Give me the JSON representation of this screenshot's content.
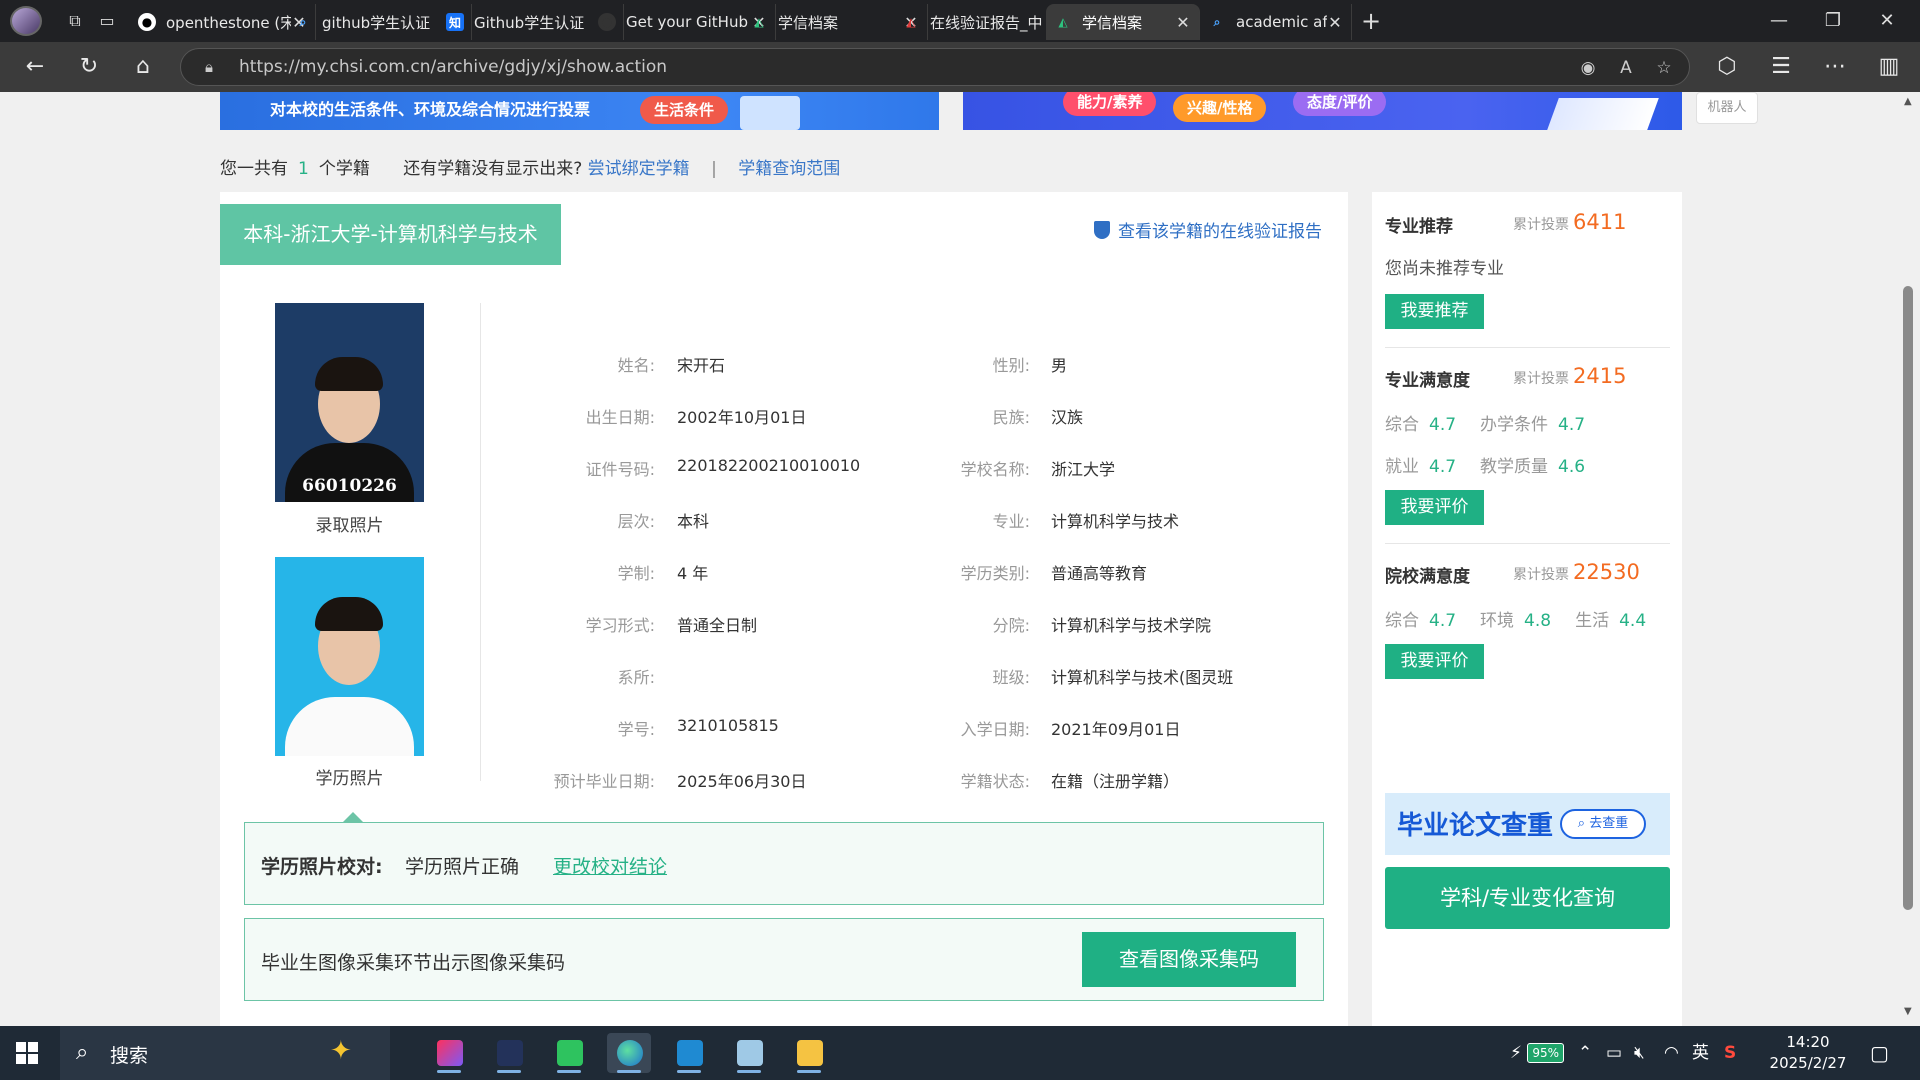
{
  "browser": {
    "tabs": [
      {
        "title": "openthestone (宋",
        "fav": "github",
        "active": false
      },
      {
        "title": "github学生认证",
        "fav": "search",
        "active": false
      },
      {
        "title": "Github学生认证",
        "fav": "zhihu",
        "active": false
      },
      {
        "title": "Get your GitHub",
        "fav": "github",
        "active": false
      },
      {
        "title": "学信档案",
        "fav": "chsi",
        "active": false
      },
      {
        "title": "在线验证报告_中",
        "fav": "chsi-red",
        "active": false
      },
      {
        "title": "学信档案",
        "fav": "chsi",
        "active": true
      },
      {
        "title": "academic affiliati",
        "fav": "search",
        "active": false
      }
    ],
    "new_tab": "+",
    "close_glyph": "✕",
    "url": "https://my.chsi.com.cn/archive/gdjy/xj/show.action"
  },
  "banners": {
    "left_text": "对本校的生活条件、环境及综合情况进行投票",
    "left_pill": "生活条件",
    "right_pills": [
      "能力/素养",
      "兴趣/性格",
      "态度/评价"
    ],
    "robot_label": "机器人"
  },
  "summary": {
    "prefix": "您一共有",
    "count": "1",
    "suffix": "个学籍",
    "question": "还有学籍没有显示出来?",
    "bind_link": "尝试绑定学籍",
    "sep": "|",
    "range_link": "学籍查询范围"
  },
  "record": {
    "title": "本科-浙江大学-计算机科学与技术",
    "verify_link": "查看该学籍的在线验证报告",
    "photo1_number": "66010226",
    "photo1_caption": "录取照片",
    "photo2_caption": "学历照片",
    "left_fields": [
      {
        "label": "姓名:",
        "value": "宋开石"
      },
      {
        "label": "出生日期:",
        "value": "2002年10月01日"
      },
      {
        "label": "证件号码:",
        "value": "220182200210010010"
      },
      {
        "label": "层次:",
        "value": "本科"
      },
      {
        "label": "学制:",
        "value": "4 年"
      },
      {
        "label": "学习形式:",
        "value": "普通全日制"
      },
      {
        "label": "系所:",
        "value": ""
      },
      {
        "label": "学号:",
        "value": "3210105815"
      },
      {
        "label": "预计毕业日期:",
        "value": "2025年06月30日"
      }
    ],
    "right_fields": [
      {
        "label": "性别:",
        "value": "男"
      },
      {
        "label": "民族:",
        "value": "汉族"
      },
      {
        "label": "学校名称:",
        "value": "浙江大学"
      },
      {
        "label": "专业:",
        "value": "计算机科学与技术"
      },
      {
        "label": "学历类别:",
        "value": "普通高等教育"
      },
      {
        "label": "分院:",
        "value": "计算机科学与技术学院"
      },
      {
        "label": "班级:",
        "value": "计算机科学与技术(图灵班"
      },
      {
        "label": "入学日期:",
        "value": "2021年09月01日"
      },
      {
        "label": "学籍状态:",
        "value": "在籍（注册学籍）"
      }
    ],
    "photo_check_label": "学历照片校对:",
    "photo_check_value": "学历照片正确",
    "photo_check_link": "更改校对结论",
    "code_text": "毕业生图像采集环节出示图像采集码",
    "code_button": "查看图像采集码"
  },
  "sidebar": {
    "votes_label": "累计投票",
    "major_rec": {
      "title": "专业推荐",
      "votes": "6411",
      "text": "您尚未推荐专业",
      "button": "我要推荐"
    },
    "major_sat": {
      "title": "专业满意度",
      "votes": "2415",
      "rows": [
        [
          {
            "k": "综合",
            "v": "4.7"
          },
          {
            "k": "办学条件",
            "v": "4.7"
          }
        ],
        [
          {
            "k": "就业",
            "v": "4.7"
          },
          {
            "k": "教学质量",
            "v": "4.6"
          }
        ]
      ],
      "button": "我要评价"
    },
    "school_sat": {
      "title": "院校满意度",
      "votes": "22530",
      "rows": [
        [
          {
            "k": "综合",
            "v": "4.7"
          },
          {
            "k": "环境",
            "v": "4.8"
          },
          {
            "k": "生活",
            "v": "4.4"
          }
        ]
      ],
      "button": "我要评价"
    },
    "ad_text": "毕业论文查重",
    "ad_button": "去查重",
    "big_button": "学科/专业变化查询"
  },
  "taskbar": {
    "search": "搜索",
    "battery": "95%",
    "ime": "英",
    "time": "14:20",
    "date": "2025/2/27"
  },
  "colors": {
    "accent": "#1fb084",
    "title_tag": "#5fc5a4",
    "link": "#2f6fc4",
    "votes": "#f36b21"
  }
}
